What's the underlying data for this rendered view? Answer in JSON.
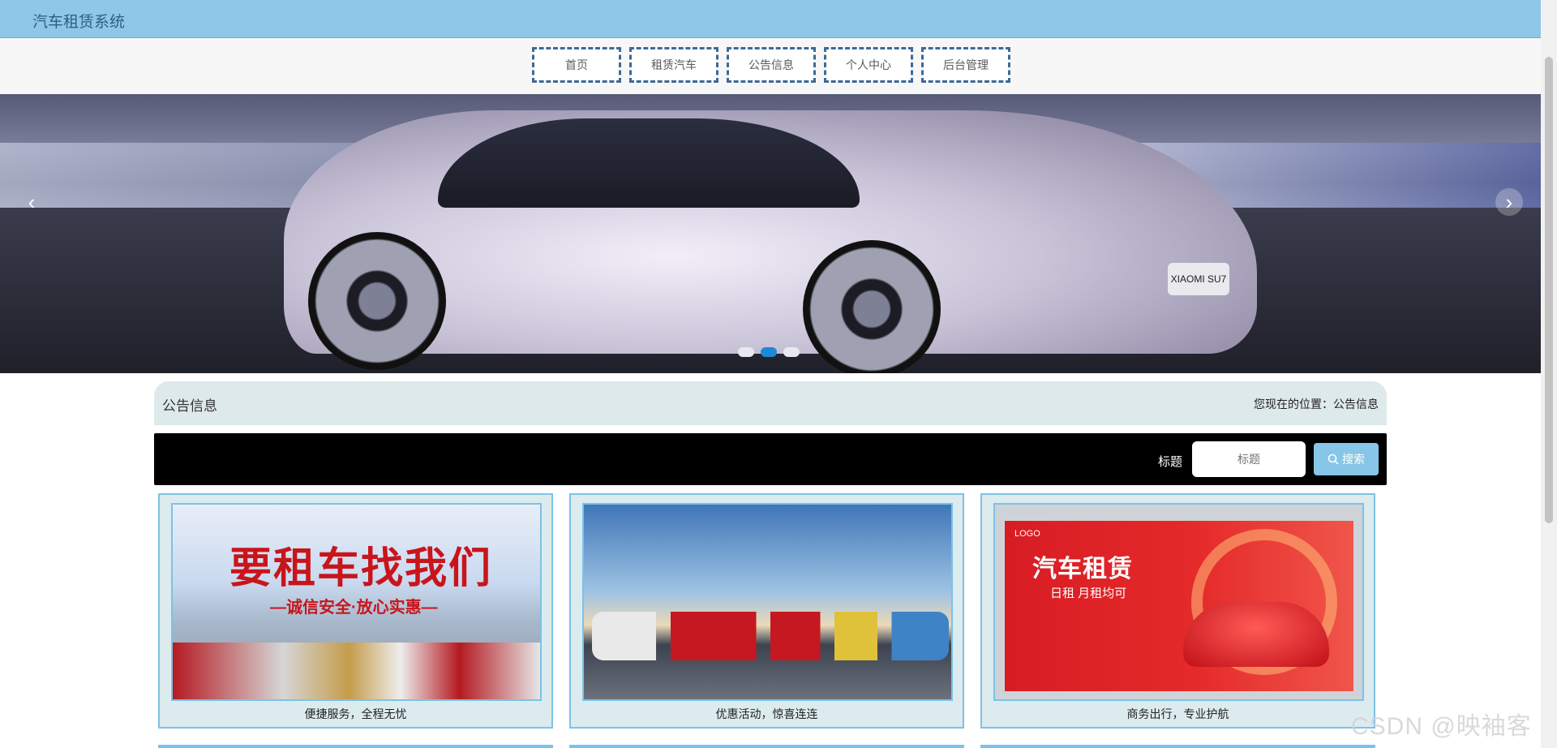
{
  "header": {
    "title": "汽车租赁系统"
  },
  "nav": {
    "items": [
      {
        "label": "首页"
      },
      {
        "label": "租赁汽车"
      },
      {
        "label": "公告信息"
      },
      {
        "label": "个人中心"
      },
      {
        "label": "后台管理"
      }
    ]
  },
  "banner": {
    "plate_text": "XIAOMI SU7",
    "prev_icon": "chevron-left-icon",
    "next_icon": "chevron-right-icon",
    "slides": 3,
    "active_slide": 2
  },
  "breadcrumb": {
    "title": "公告信息",
    "location": "您现在的位置：公告信息"
  },
  "search": {
    "label": "标题",
    "placeholder": "标题",
    "button_label": "搜索",
    "button_icon": "search-icon",
    "accent_color": "#87c6e6"
  },
  "cards": [
    {
      "caption": "便捷服务，全程无忧",
      "image": {
        "headline": "要租车找我们",
        "subline": "—诚信安全·放心实惠—"
      }
    },
    {
      "caption": "优惠活动，惊喜连连",
      "image": {}
    },
    {
      "caption": "商务出行，专业护航",
      "image": {
        "logo": "LOGO",
        "headline": "汽车租赁",
        "subline": "日租  月租均可"
      }
    }
  ],
  "watermark": "CSDN @映袖客",
  "colors": {
    "header_bg": "#8ec8e6",
    "nav_border": "#3d6a96",
    "card_border": "#7cc2e8",
    "card_bg": "#dcebee",
    "breadcrumb_bg": "#dde9ea"
  }
}
